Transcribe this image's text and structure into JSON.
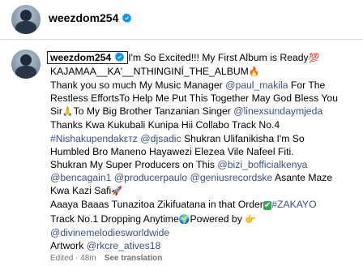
{
  "header": {
    "username": "weezdom254"
  },
  "comment": {
    "username": "weezdom254",
    "lines": [
      [
        {
          "t": "text",
          "v": "I'm So Excited!!! My First Album is Ready"
        },
        {
          "t": "emoji",
          "v": "💯",
          "cls": "e-red"
        }
      ],
      [
        {
          "t": "text",
          "v": "KAJAMAA__KA'__NTHINGINÍ_THE_ALBUM"
        },
        {
          "t": "emoji",
          "v": "🔥",
          "cls": "e-fire"
        }
      ],
      [
        {
          "t": "text",
          "v": "Thank you so much My Music Manager "
        },
        {
          "t": "link",
          "v": "@paul_makila"
        },
        {
          "t": "text",
          "v": " For The"
        }
      ],
      [
        {
          "t": "text",
          "v": "Restless EffortsTo Help Me Put This Together May God Bless You"
        }
      ],
      [
        {
          "t": "text",
          "v": "Sir"
        },
        {
          "t": "emoji",
          "v": "🙏",
          "cls": "e-gold"
        },
        {
          "t": "text",
          "v": "To My Big Brother Tanzanian Singer "
        },
        {
          "t": "link",
          "v": "@linexsundaymjeda"
        }
      ],
      [
        {
          "t": "text",
          "v": "Thanks Kwa Kukubali Kunipa Hii Collabo Track No.4"
        }
      ],
      [
        {
          "t": "link",
          "v": "#Nishakupendakεтz"
        },
        {
          "t": "text",
          "v": " "
        },
        {
          "t": "link",
          "v": "@djsadic"
        },
        {
          "t": "text",
          "v": " Shukran Ulifanikisha I'm So"
        }
      ],
      [
        {
          "t": "text",
          "v": "Humbled Bro Maneno Hayawezi Elezea Vile Nafeel Fiti."
        }
      ],
      [
        {
          "t": "text",
          "v": "Shukran My Super Producers on This "
        },
        {
          "t": "link",
          "v": "@bizi_bofficialkenya"
        }
      ],
      [
        {
          "t": "link",
          "v": "@bencagain1"
        },
        {
          "t": "text",
          "v": " "
        },
        {
          "t": "link",
          "v": "@producerpaulo"
        },
        {
          "t": "text",
          "v": " "
        },
        {
          "t": "link",
          "v": "@geniusrecordske"
        },
        {
          "t": "text",
          "v": " Asante Maze"
        }
      ],
      [
        {
          "t": "text",
          "v": "Kwa Kazi Safi"
        },
        {
          "t": "emoji",
          "v": "🚀",
          "cls": "e-red"
        }
      ],
      [
        {
          "t": "text",
          "v": "Aaaya Baaas Tunazitoa Zikifuatana in that Order"
        },
        {
          "t": "emoji",
          "v": "✔",
          "cls": "e-green"
        },
        {
          "t": "link",
          "v": "#ZAKAYO"
        }
      ],
      [
        {
          "t": "text",
          "v": "Track No.1 Dropping Anytime"
        },
        {
          "t": "emoji",
          "v": "🌍",
          "cls": "e-globe"
        },
        {
          "t": "text",
          "v": "Powered by "
        },
        {
          "t": "emoji",
          "v": "👉",
          "cls": "e-gold"
        }
      ],
      [
        {
          "t": "link",
          "v": "@divinemelodiesworldwide"
        }
      ],
      [
        {
          "t": "text",
          "v": "Artwork "
        },
        {
          "t": "link",
          "v": "@rkcre_atives18"
        }
      ]
    ]
  },
  "meta": {
    "edited": "Edited · 48m",
    "see_translation": "See translation"
  },
  "colors": {
    "link": "#385185",
    "verified": "#0095f6",
    "secondary_text": "#737373",
    "divider": "#dbdbdb"
  }
}
